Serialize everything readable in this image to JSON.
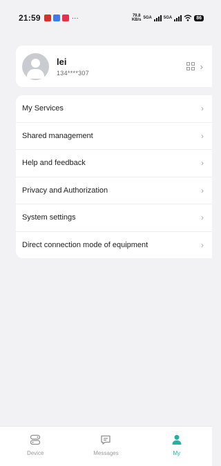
{
  "status_bar": {
    "time": "21:59",
    "network_speed": "79.8",
    "network_unit": "KB/s",
    "sim1": "5GA",
    "sim2": "5GA",
    "battery": "86",
    "more_indicator": "···"
  },
  "profile": {
    "name": "lei",
    "phone": "134****307"
  },
  "menu": {
    "items": [
      {
        "label": "My Services"
      },
      {
        "label": "Shared management"
      },
      {
        "label": "Help and feedback"
      },
      {
        "label": "Privacy and Authorization"
      },
      {
        "label": "System settings"
      },
      {
        "label": "Direct connection mode of equipment"
      }
    ]
  },
  "tabbar": {
    "tabs": [
      {
        "label": "Device",
        "icon": "device-icon",
        "active": false
      },
      {
        "label": "Messages",
        "icon": "messages-icon",
        "active": false
      },
      {
        "label": "My",
        "icon": "person-icon",
        "active": true
      }
    ]
  },
  "colors": {
    "accent": "#1fb3a0",
    "background": "#f2f2f4",
    "card": "#ffffff"
  }
}
